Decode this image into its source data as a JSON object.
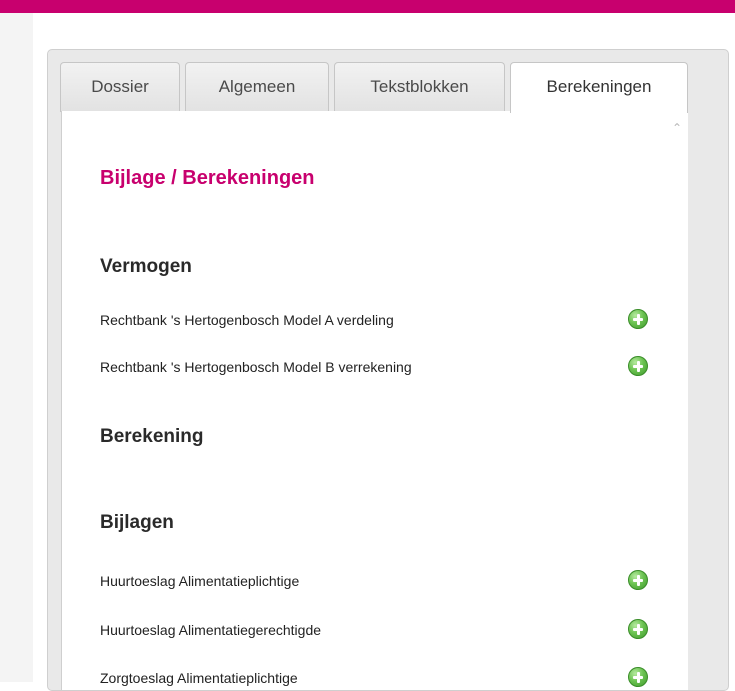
{
  "tabs": [
    {
      "label": "Dossier",
      "active": false
    },
    {
      "label": "Algemeen",
      "active": false
    },
    {
      "label": "Tekstblokken",
      "active": false
    },
    {
      "label": "Berekeningen",
      "active": true
    }
  ],
  "page": {
    "title": "Bijlage / Berekeningen"
  },
  "sections": [
    {
      "title": "Vermogen",
      "items": [
        {
          "label": "Rechtbank 's Hertogenbosch Model A verdeling",
          "icon": "add-icon"
        },
        {
          "label": "Rechtbank 's Hertogenbosch Model B verrekening",
          "icon": "add-icon"
        }
      ]
    },
    {
      "title": "Berekening",
      "items": []
    },
    {
      "title": "Bijlagen",
      "items": [
        {
          "label": "Huurtoeslag Alimentatieplichtige",
          "icon": "add-icon"
        },
        {
          "label": "Huurtoeslag Alimentatiegerechtigde",
          "icon": "add-icon"
        },
        {
          "label": "Zorgtoeslag Alimentatieplichtige",
          "icon": "add-icon"
        }
      ]
    }
  ],
  "colors": {
    "brand": "#c8006e",
    "add_icon": "#5cb848"
  }
}
